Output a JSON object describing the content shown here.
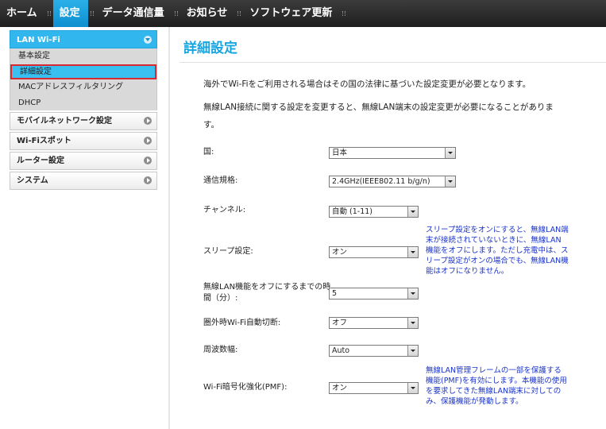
{
  "nav": {
    "items": [
      {
        "label": "ホーム"
      },
      {
        "label": "設定"
      },
      {
        "label": "データ通信量"
      },
      {
        "label": "お知らせ"
      },
      {
        "label": "ソフトウェア更新"
      }
    ],
    "active_index": 1
  },
  "sidebar": {
    "lan_wifi": {
      "label": "LAN Wi-Fi",
      "items": [
        {
          "label": "基本設定"
        },
        {
          "label": "詳細設定"
        },
        {
          "label": "MACアドレスフィルタリング"
        },
        {
          "label": "DHCP"
        }
      ]
    },
    "sections": [
      {
        "label": "モバイルネットワーク設定"
      },
      {
        "label": "Wi-Fiスポット"
      },
      {
        "label": "ルーター設定"
      },
      {
        "label": "システム"
      }
    ]
  },
  "main": {
    "title": "詳細設定",
    "desc1": "海外でWi-Fiをご利用される場合はその国の法律に基づいた設定変更が必要となります。",
    "desc2_line1": "無線LAN接続に関する設定を変更すると、無線LAN端末の設定変更が必要になることがありま",
    "desc2_line2": "す。",
    "fields": {
      "country": {
        "label": "国:",
        "value": "日本"
      },
      "standard": {
        "label": "通信規格:",
        "value": "2.4GHz(IEEE802.11 b/g/n)"
      },
      "channel": {
        "label": "チャンネル:",
        "value": "自動 (1-11)"
      },
      "sleep": {
        "label": "スリープ設定:",
        "value": "オン",
        "note": "スリープ設定をオンにすると、無線LAN端末が接続されていないときに、無線LAN機能をオフにします。ただし充電中は、スリープ設定がオンの場合でも、無線LAN機能はオフになりません。"
      },
      "sleep_time": {
        "label_line1": "無線LAN機能をオフにするまでの時",
        "label_line2": "間（分）:",
        "value": "5"
      },
      "auto_off": {
        "label": "圏外時Wi-Fi自動切断:",
        "value": "オフ"
      },
      "bandwidth": {
        "label": "周波数幅:",
        "value": "Auto"
      },
      "pmf": {
        "label": "Wi-Fi暗号化強化(PMF):",
        "value": "オン",
        "note": "無線LAN管理フレームの一部を保護する機能(PMF)を有効にします。本機能の使用を要求してきた無線LAN端末に対してのみ、保護機能が発動します。"
      }
    }
  }
}
